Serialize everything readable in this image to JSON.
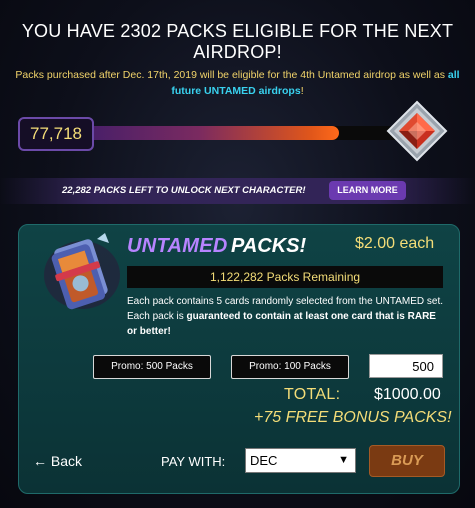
{
  "header": {
    "title": "YOU HAVE 2302 PACKS ELIGIBLE FOR THE NEXT AIRDROP!",
    "subtitle_prefix": "Packs purchased after Dec. 17th, 2019 will be eligible for the 4th Untamed airdrop as well as ",
    "subtitle_highlight": "all future UNTAMED airdrops",
    "subtitle_suffix": "!"
  },
  "progress": {
    "count": "77,718",
    "fill_fraction": 0.78,
    "gem_icon": "red-gem-icon"
  },
  "unlock": {
    "text": "22,282 PACKS LEFT TO UNLOCK NEXT CHARACTER!",
    "learn_more": "LEARN MORE"
  },
  "product": {
    "image_icon": "untamed-pack-icon",
    "name_colored": "UNTAMED",
    "name_rest": "PACKS!",
    "price": "$2.00 each",
    "remaining": "1,122,282 Packs Remaining",
    "desc_part1": "Each pack contains 5 cards randomly selected from the UNTAMED set. Each pack is ",
    "desc_bold": "guaranteed to contain at least one card that is RARE or better!"
  },
  "purchase": {
    "promo_500": "Promo: 500 Packs",
    "promo_100": "Promo: 100 Packs",
    "quantity": "500",
    "total_label": "TOTAL:",
    "total_value": "$1000.00",
    "bonus": "+75 FREE BONUS PACKS!",
    "back": "← Back",
    "pay_with": "PAY WITH:",
    "currency": "DEC",
    "buy": "BUY"
  },
  "colors": {
    "accent_gold": "#f4dd78",
    "accent_purple": "#b784ff",
    "highlight_cyan": "#39d2ef",
    "panel_teal": "#0f4345",
    "buy_orange": "#7a3a12"
  }
}
